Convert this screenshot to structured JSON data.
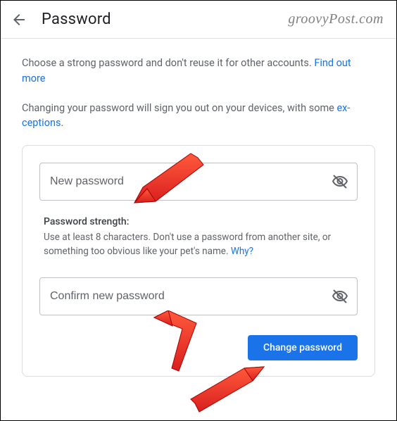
{
  "header": {
    "title": "Password",
    "watermark": "groovyPost.com"
  },
  "intro": {
    "line1_part1": "Choose a strong password and don't reuse it for other accounts. ",
    "line1_link1": "Find out ",
    "line1_link2": "more",
    "line2_part1": "Changing your password will sign you out on your devices, with some ",
    "line2_link1": "ex-",
    "line2_link2": "ceptions",
    "line2_suffix": "."
  },
  "form": {
    "new_password_placeholder": "New password",
    "strength_title": "Password strength:",
    "strength_text_part1": "Use at least 8 characters. Don't use a password from another site, or something too obvious like your pet's name. ",
    "strength_link": "Why?",
    "confirm_placeholder": "Confirm new password",
    "submit_label": "Change password"
  }
}
